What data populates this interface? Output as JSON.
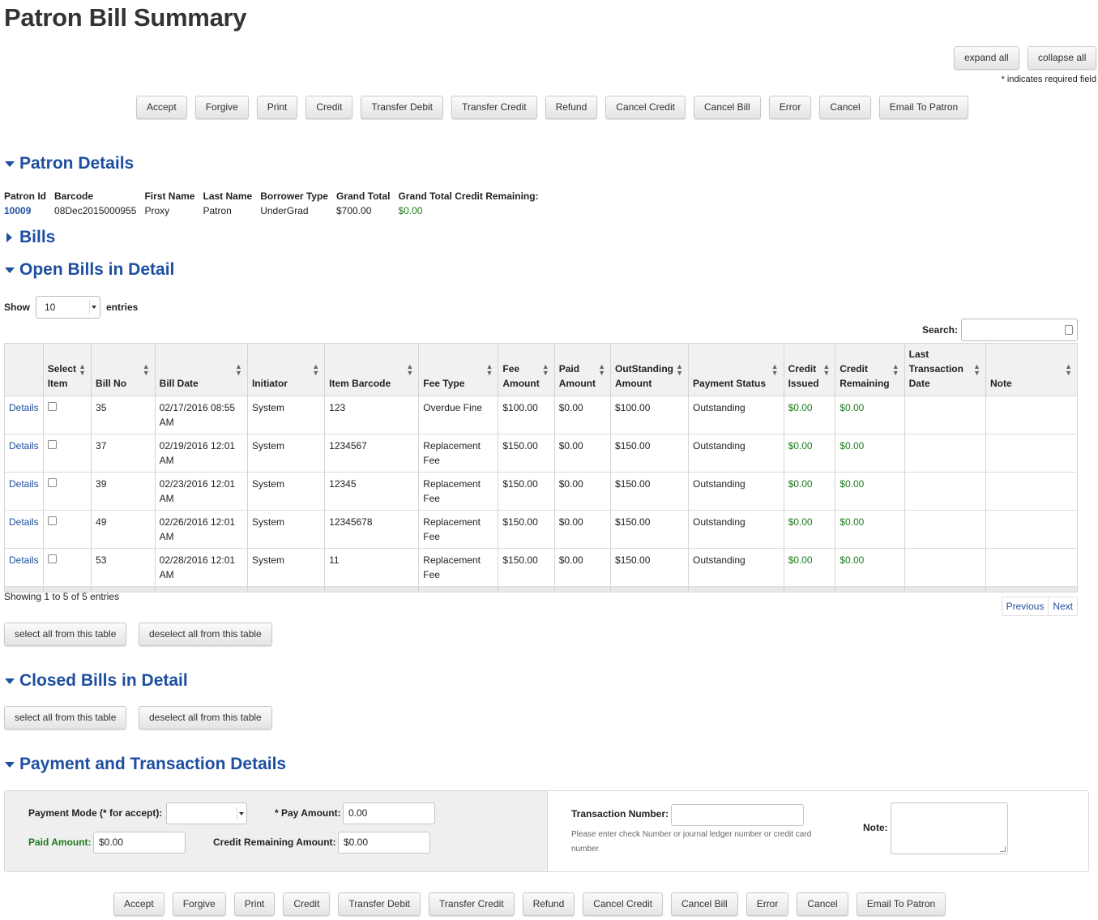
{
  "page_title": "Patron Bill Summary",
  "expand_label": "expand all",
  "collapse_label": "collapse all",
  "required_note": "* indicates required field",
  "actions": [
    "Accept",
    "Forgive",
    "Print",
    "Credit",
    "Transfer Debit",
    "Transfer Credit",
    "Refund",
    "Cancel Credit",
    "Cancel Bill",
    "Error",
    "Cancel",
    "Email To Patron"
  ],
  "sections": {
    "patron_details": "Patron Details",
    "bills": "Bills",
    "open_bills": "Open Bills in Detail",
    "closed_bills": "Closed Bills in Detail",
    "payment": "Payment and Transaction Details"
  },
  "patron": {
    "headers": [
      "Patron Id",
      "Barcode",
      "First Name",
      "Last Name",
      "Borrower Type",
      "Grand Total",
      "Grand Total Credit Remaining:"
    ],
    "values": [
      "10009",
      "08Dec2015000955",
      "Proxy",
      "Patron",
      "UnderGrad",
      "$700.00",
      "$0.00"
    ]
  },
  "table_controls": {
    "show_label": "Show",
    "entries_label": "entries",
    "page_size": "10",
    "search_label": "Search:",
    "showing_text": "Showing 1 to 5 of 5 entries",
    "previous": "Previous",
    "next": "Next",
    "select_all": "select all from this table",
    "deselect_all": "deselect all from this table"
  },
  "columns": [
    "",
    "Select Item",
    "Bill No",
    "Bill Date",
    "Initiator",
    "Item Barcode",
    "Fee Type",
    "Fee Amount",
    "Paid Amount",
    "OutStanding Amount",
    "Payment Status",
    "Credit Issued",
    "Credit Remaining",
    "Last Transaction Date",
    "Note"
  ],
  "rows": [
    {
      "link": "Details",
      "bill_no": "35",
      "bill_date": "02/17/2016 08:55 AM",
      "initiator": "System",
      "item_barcode": "123",
      "fee_type": "Overdue Fine",
      "fee_amount": "$100.00",
      "paid_amount": "$0.00",
      "outstanding": "$100.00",
      "status": "Outstanding",
      "credit_issued": "$0.00",
      "credit_remaining": "$0.00",
      "last_tx": "",
      "note": ""
    },
    {
      "link": "Details",
      "bill_no": "37",
      "bill_date": "02/19/2016 12:01 AM",
      "initiator": "System",
      "item_barcode": "1234567",
      "fee_type": "Replacement Fee",
      "fee_amount": "$150.00",
      "paid_amount": "$0.00",
      "outstanding": "$150.00",
      "status": "Outstanding",
      "credit_issued": "$0.00",
      "credit_remaining": "$0.00",
      "last_tx": "",
      "note": ""
    },
    {
      "link": "Details",
      "bill_no": "39",
      "bill_date": "02/23/2016 12:01 AM",
      "initiator": "System",
      "item_barcode": "12345",
      "fee_type": "Replacement Fee",
      "fee_amount": "$150.00",
      "paid_amount": "$0.00",
      "outstanding": "$150.00",
      "status": "Outstanding",
      "credit_issued": "$0.00",
      "credit_remaining": "$0.00",
      "last_tx": "",
      "note": ""
    },
    {
      "link": "Details",
      "bill_no": "49",
      "bill_date": "02/26/2016 12:01 AM",
      "initiator": "System",
      "item_barcode": "12345678",
      "fee_type": "Replacement Fee",
      "fee_amount": "$150.00",
      "paid_amount": "$0.00",
      "outstanding": "$150.00",
      "status": "Outstanding",
      "credit_issued": "$0.00",
      "credit_remaining": "$0.00",
      "last_tx": "",
      "note": ""
    },
    {
      "link": "Details",
      "bill_no": "53",
      "bill_date": "02/28/2016 12:01 AM",
      "initiator": "System",
      "item_barcode": "11",
      "fee_type": "Replacement Fee",
      "fee_amount": "$150.00",
      "paid_amount": "$0.00",
      "outstanding": "$150.00",
      "status": "Outstanding",
      "credit_issued": "$0.00",
      "credit_remaining": "$0.00",
      "last_tx": "",
      "note": ""
    }
  ],
  "payment": {
    "mode_label": "Payment Mode (* for accept):",
    "mode_value": "",
    "pay_amount_label": "* Pay Amount:",
    "pay_amount_value": "0.00",
    "paid_amount_label": "Paid Amount:",
    "paid_amount_value": "$0.00",
    "credit_remaining_label": "Credit Remaining Amount:",
    "credit_remaining_value": "$0.00",
    "transaction_label": "Transaction Number:",
    "transaction_value": "",
    "transaction_help": "Please enter check Number or journal ledger number or credit card number",
    "note_label": "Note:"
  },
  "colors": {
    "link": "#1e4fa0",
    "credit_green": "#1d7a1d"
  }
}
